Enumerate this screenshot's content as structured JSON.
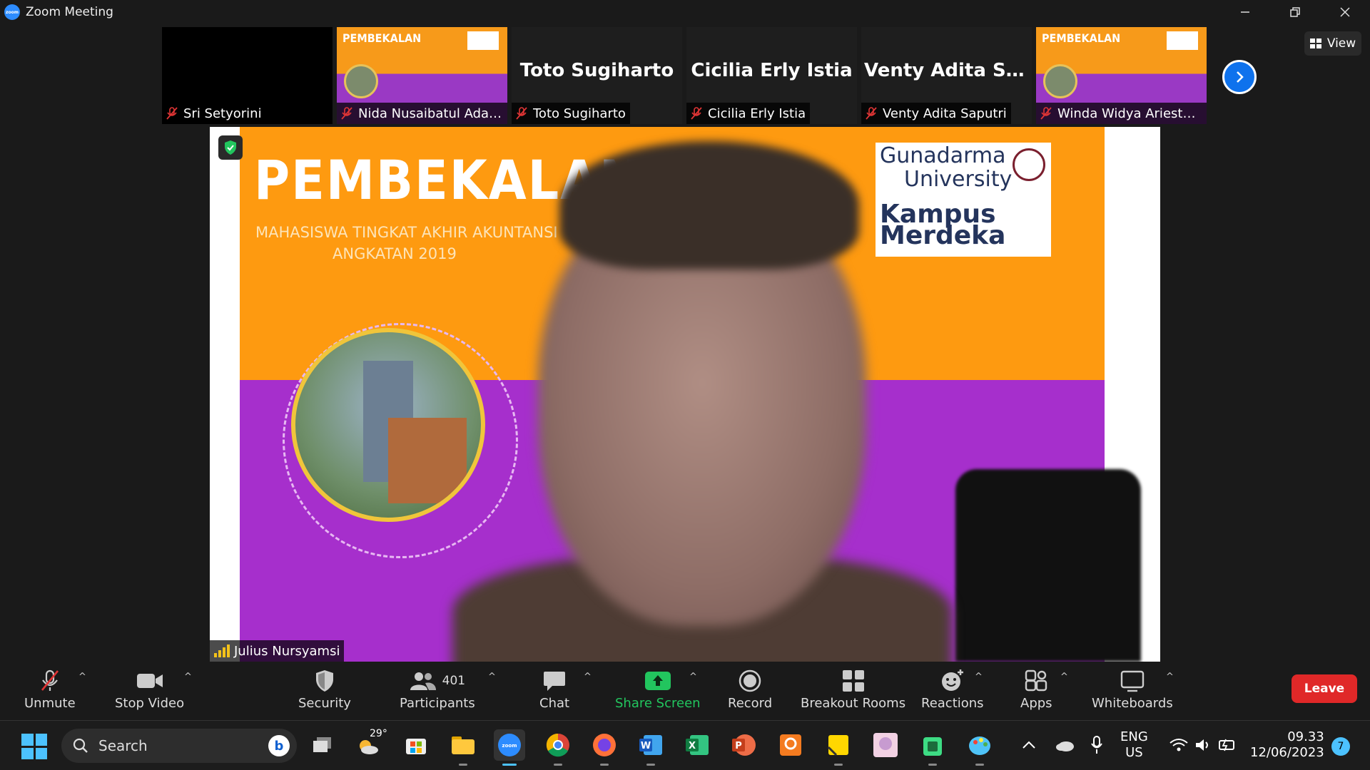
{
  "window": {
    "title": "Zoom Meeting",
    "app_icon_text": "zoom"
  },
  "thumbnails": [
    {
      "name": "Sri Setyorini",
      "big_name": "",
      "type": "black"
    },
    {
      "name": "Nida Nusaibatul Adaw...",
      "big_name": "",
      "type": "poster"
    },
    {
      "name": "Toto Sugiharto",
      "big_name": "Toto Sugiharto",
      "type": "text"
    },
    {
      "name": "Cicilia Erly Istia",
      "big_name": "Cicilia Erly Istia",
      "type": "text"
    },
    {
      "name": "Venty Adita Saputri",
      "big_name": "Venty  Adita  Sap...",
      "type": "text"
    },
    {
      "name": "Winda Widya Ariestya ...",
      "big_name": "",
      "type": "poster"
    }
  ],
  "view_button": {
    "label": "View"
  },
  "main_video": {
    "speaker_name": "Julius Nursyamsi",
    "poster": {
      "title": "PEMBEKALAN",
      "subtitle_line1": "MAHASISWA TINGKAT AKHIR AKUNTANSI",
      "subtitle_line2": "ANGKATAN 2019",
      "logo_line1": "Gunadarma",
      "logo_line2": "University",
      "logo_line3": "Kampus",
      "logo_line4": "Merdeka"
    },
    "mini_poster_title": "PEMBEKALAN"
  },
  "toolbar": {
    "unmute": "Unmute",
    "stop_video": "Stop Video",
    "security": "Security",
    "participants": "Participants",
    "participants_count": "401",
    "chat": "Chat",
    "share_screen": "Share Screen",
    "record": "Record",
    "breakout_rooms": "Breakout Rooms",
    "reactions": "Reactions",
    "apps": "Apps",
    "whiteboards": "Whiteboards",
    "leave": "Leave"
  },
  "taskbar": {
    "search_placeholder": "Search",
    "weather_temp": "29°",
    "language_line1": "ENG",
    "language_line2": "US",
    "time": "09.33",
    "date": "12/06/2023",
    "notification_count": "7"
  },
  "colors": {
    "zoom_blue": "#0e72ed",
    "leave_red": "#e02828",
    "share_green": "#22c55e",
    "poster_orange": "#fe9a10",
    "poster_purple": "#a62fcc"
  }
}
